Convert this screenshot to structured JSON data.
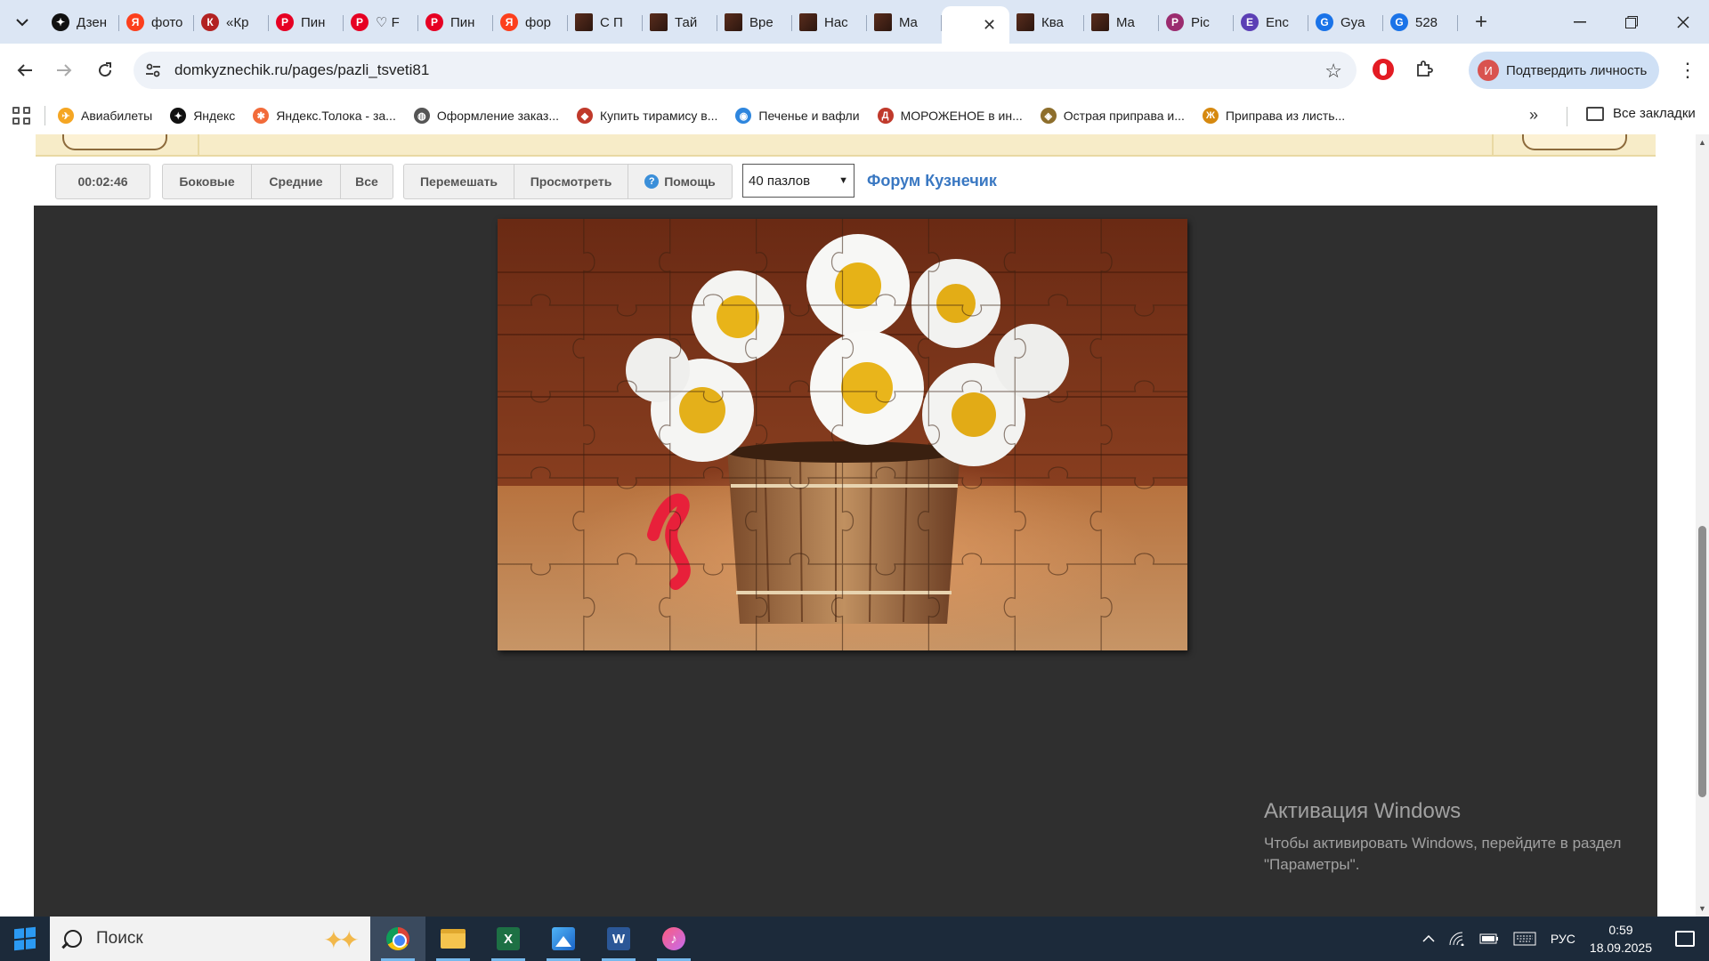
{
  "browser": {
    "tabs": [
      {
        "label": "Дзен",
        "icon": "dzen-icon",
        "color": "#111111",
        "glyph": "✦"
      },
      {
        "label": "фото",
        "icon": "yandex-icon",
        "color": "#fc3f1d",
        "glyph": "Я"
      },
      {
        "label": "«Кр",
        "icon": "site-icon",
        "color": "#b22222",
        "glyph": "К"
      },
      {
        "label": "Пин",
        "icon": "pinterest-icon",
        "color": "#e60023",
        "glyph": "P"
      },
      {
        "label": "♡ F",
        "icon": "pinterest-icon",
        "color": "#e60023",
        "glyph": "P"
      },
      {
        "label": "Пин",
        "icon": "pinterest-icon",
        "color": "#e60023",
        "glyph": "P"
      },
      {
        "label": "фор",
        "icon": "yandex-icon",
        "color": "#fc3f1d",
        "glyph": "Я"
      },
      {
        "label": "С П",
        "icon": "domkyznechik-icon",
        "color": "#4a2618",
        "glyph": ""
      },
      {
        "label": "Тай",
        "icon": "domkyznechik-icon",
        "color": "#4a2618",
        "glyph": ""
      },
      {
        "label": "Вре",
        "icon": "domkyznechik-icon",
        "color": "#4a2618",
        "glyph": ""
      },
      {
        "label": "Нас",
        "icon": "domkyznechik-icon",
        "color": "#4a2618",
        "glyph": ""
      },
      {
        "label": "Ma",
        "icon": "domkyznechik-icon",
        "color": "#4a2618",
        "glyph": ""
      }
    ],
    "active_tab": {
      "label": "",
      "icon": "domkyznechik-icon"
    },
    "tabs_after": [
      {
        "label": "Ква",
        "icon": "domkyznechik-icon",
        "color": "#4a2618",
        "glyph": ""
      },
      {
        "label": "Ma",
        "icon": "domkyznechik-icon",
        "color": "#4a2618",
        "glyph": ""
      },
      {
        "label": "Pic",
        "icon": "picsart-icon",
        "color": "#9b2c6f",
        "glyph": "P"
      },
      {
        "label": "Enc",
        "icon": "wizard-icon",
        "color": "#5b3fb5",
        "glyph": "E"
      },
      {
        "label": "Gya",
        "icon": "translate-icon",
        "color": "#1a73e8",
        "glyph": "G"
      },
      {
        "label": "528",
        "icon": "translate-icon",
        "color": "#1a73e8",
        "glyph": "G"
      }
    ],
    "url": "domkyznechik.ru/pages/pazli_tsveti81",
    "profile_label": "Подтвердить личность",
    "profile_initial": "И",
    "bookmarks": [
      {
        "label": "Авиабилеты",
        "icon": "plane-icon",
        "color": "#f5a623",
        "glyph": "✈"
      },
      {
        "label": "Яндекс",
        "icon": "yandex-plus-icon",
        "color": "#111111",
        "glyph": "✦"
      },
      {
        "label": "Яндекс.Толока - за...",
        "icon": "toloka-icon",
        "color": "#f26b3a",
        "glyph": "✱"
      },
      {
        "label": "Оформление заказ...",
        "icon": "globe-icon",
        "color": "#555555",
        "glyph": "◍"
      },
      {
        "label": "Купить тирамису в...",
        "icon": "shop-icon",
        "color": "#c0392b",
        "glyph": "◆"
      },
      {
        "label": "Печенье и вафли",
        "icon": "cookie-icon",
        "color": "#2e86de",
        "glyph": "◉"
      },
      {
        "label": "МОРОЖЕНОЕ в ин...",
        "icon": "d-icon",
        "color": "#c0392b",
        "glyph": "Д"
      },
      {
        "label": "Острая приправа и...",
        "icon": "spice-icon",
        "color": "#8d6e2c",
        "glyph": "◈"
      },
      {
        "label": "Приправа из листь...",
        "icon": "ж-icon",
        "color": "#d68910",
        "glyph": "Ж"
      }
    ],
    "all_bookmarks_label": "Все закладки"
  },
  "puzzle_page": {
    "timer": "00:02:46",
    "filter_buttons": [
      "Боковые",
      "Средние",
      "Все"
    ],
    "action_buttons": [
      "Перемешать",
      "Просмотреть"
    ],
    "help_label": "Помощь",
    "pieces_select": "40 пазлов",
    "forum_link": "Форум Кузнечик"
  },
  "watermark": {
    "title": "Активация Windows",
    "text": "Чтобы активировать Windows, перейдите в раздел \"Параметры\"."
  },
  "taskbar": {
    "search_placeholder": "Поиск",
    "language": "РУС",
    "time": "0:59",
    "date": "18.09.2025"
  }
}
